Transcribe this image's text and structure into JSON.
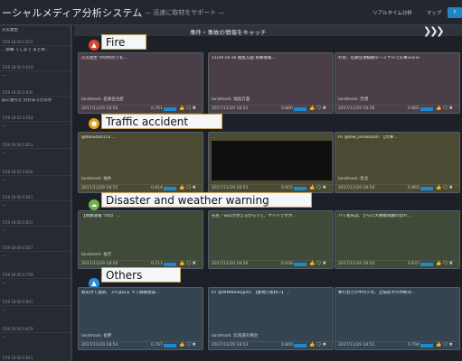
{
  "app": {
    "title": "ーシャルメディア分析システム",
    "subtitle": "— 迅速に取材をサポート —",
    "nav": {
      "realtime": "リアルタイム分析",
      "map": "マップ",
      "extra": "f"
    }
  },
  "colors": {
    "accent": "#1e88d0",
    "fire": "#d9472b",
    "traffic": "#e4a21b",
    "disaster": "#6fb34a",
    "others": "#2a8fd6"
  },
  "sidebar": {
    "items": [
      {
        "text": "火災発生",
        "meta": "7/29 18:56   0.972"
      },
      {
        "text": "…目撃 てしまう まとめ…",
        "meta": "7/29 18:56   0.919"
      },
      {
        "text": "…",
        "meta": "7/29 18:56   0.935"
      },
      {
        "text": "前に落ちた 何かあったのか",
        "meta": "7/29 18:55   0.914"
      },
      {
        "text": "…",
        "meta": "7/29 18:56   0.851"
      },
      {
        "text": "…",
        "meta": "7/29 18:55   0.926"
      },
      {
        "text": "…",
        "meta": "7/29 18:56   0.811"
      },
      {
        "text": "…",
        "meta": "7/29 18:56   0.851"
      },
      {
        "text": "…",
        "meta": "7/29 18:56   0.857"
      },
      {
        "text": "…",
        "meta": "7/29 18:56   0.759"
      },
      {
        "text": "…",
        "meta": "7/29 18:56   0.857"
      },
      {
        "text": "…",
        "meta": "7/29 18:56   0.879"
      },
      {
        "text": "…",
        "meta": "7/29 18:56   0.811"
      }
    ]
  },
  "main": {
    "header": "事件・事故の情報をキャッチ",
    "chevrons": "❯❯❯",
    "sections": {
      "fire": {
        "label": "Fire",
        "cards": [
          {
            "text": "火災発生 今の時点でも…",
            "landmark": "landmark: 名鉄名古屋",
            "date": "2017/11/29 18:56",
            "score": "0.761"
          },
          {
            "text": "11/29 16:16 福島方面 目撃情報…",
            "landmark": "landmark: 福島方面",
            "date": "2017/11/29 18:52",
            "score": "0.860"
          },
          {
            "text": "わお、名鉄空港線線ターミナルで火事ｗｗｗ",
            "landmark": "landmark: 空港",
            "date": "2017/11/29 18:56",
            "score": "0.881"
          }
        ]
      },
      "traffic": {
        "label": "Traffic accident",
        "cards": [
          {
            "text": "@Kokudo0112 …",
            "landmark": "landmark: 福井",
            "date": "2017/11/29 18:55",
            "score": "0.814"
          },
          {
            "text": "…",
            "landmark": "",
            "date": "2017/11/29 18:55",
            "score": "0.855"
          },
          {
            "text": "RT @tow_unnoluton: 【大事…",
            "landmark": "landmark: 急北",
            "date": "2017/11/29 18:54",
            "score": "0.865"
          }
        ]
      },
      "disaster": {
        "label": "Disaster and weather warning",
        "cards": [
          {
            "text": "【地震速報 つの】 …",
            "landmark": "landmark: 金沢",
            "date": "2017/11/29 18:56",
            "score": "0.711"
          },
          {
            "text": "先名「白山が見えるからって、ヤバイですが…",
            "landmark": "",
            "date": "2017/11/29 18:56",
            "score": "0.638"
          },
          {
            "text": "バリ長先は、さらに大規模地震の恐れ…",
            "landmark": "",
            "date": "2017/11/29 18:54",
            "score": "0.637"
          }
        ]
      },
      "others": {
        "label": "Others",
        "cards": [
          {
            "text": "無気付て連絡、 3人は白る ４１線路建築…",
            "landmark": "landmark: 長野",
            "date": "2017/11/29 18:54",
            "score": "0.767"
          },
          {
            "text": "RT @NHKNewsjpoS: 【警視庁抜粋い】…",
            "landmark": "landmark: 北海道の場合",
            "date": "2017/11/29 18:53",
            "score": "0.800"
          },
          {
            "text": "夢引合さの中の少年、立揃程すの判断的…",
            "landmark": "",
            "date": "2017/11/29 18:51",
            "score": "0.794"
          }
        ]
      }
    },
    "card_actions": "👍🗨✖"
  }
}
